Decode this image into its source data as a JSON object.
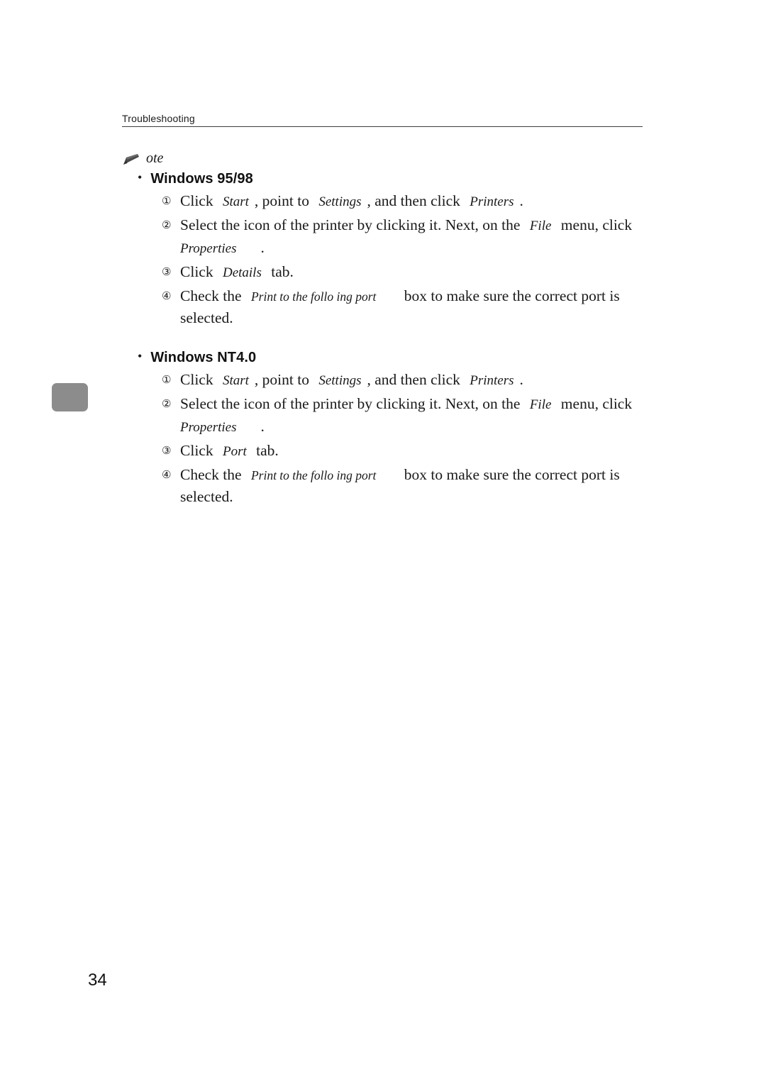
{
  "header": {
    "chapter_label": "Troubleshooting"
  },
  "note": {
    "icon": "pencil-icon",
    "label": "ote"
  },
  "sections": [
    {
      "bullet": "•",
      "title": "Windows 95/98",
      "steps": [
        {
          "num": "①",
          "parts": [
            {
              "t": "Click ",
              "s": "plain"
            },
            {
              "t": "Start",
              "s": "kw"
            },
            {
              "t": ", point to ",
              "s": "plain"
            },
            {
              "t": "Settings",
              "s": "kw"
            },
            {
              "t": ", and then click ",
              "s": "plain"
            },
            {
              "t": "Printers",
              "s": "kw"
            },
            {
              "t": ".",
              "s": "plain"
            }
          ]
        },
        {
          "num": "②",
          "parts": [
            {
              "t": "Select the icon of the printer by clicking it. Next, on the ",
              "s": "plain"
            },
            {
              "t": "File",
              "s": "kw"
            },
            {
              "t": " menu, click ",
              "s": "plain"
            },
            {
              "t": "Properties",
              "s": "kw-break"
            },
            {
              "t": ".",
              "s": "plain"
            }
          ]
        },
        {
          "num": "③",
          "parts": [
            {
              "t": "Click ",
              "s": "plain"
            },
            {
              "t": "Details",
              "s": "kw"
            },
            {
              "t": " tab.",
              "s": "plain"
            }
          ]
        },
        {
          "num": "④",
          "parts": [
            {
              "t": "Check the ",
              "s": "plain"
            },
            {
              "t": "Print to the follo ing port",
              "s": "kw-small"
            },
            {
              "t": " box to make sure the correct port is selected.",
              "s": "plain"
            }
          ]
        }
      ]
    },
    {
      "bullet": "•",
      "title": "Windows NT4.0",
      "steps": [
        {
          "num": "①",
          "parts": [
            {
              "t": "Click ",
              "s": "plain"
            },
            {
              "t": "Start",
              "s": "kw"
            },
            {
              "t": ", point to ",
              "s": "plain"
            },
            {
              "t": "Settings",
              "s": "kw"
            },
            {
              "t": ", and then click ",
              "s": "plain"
            },
            {
              "t": "Printers",
              "s": "kw"
            },
            {
              "t": ".",
              "s": "plain"
            }
          ]
        },
        {
          "num": "②",
          "parts": [
            {
              "t": "Select the icon of the printer by clicking it. Next, on the ",
              "s": "plain"
            },
            {
              "t": "File",
              "s": "kw"
            },
            {
              "t": " menu, click ",
              "s": "plain"
            },
            {
              "t": "Properties",
              "s": "kw-break"
            },
            {
              "t": ".",
              "s": "plain"
            }
          ]
        },
        {
          "num": "③",
          "parts": [
            {
              "t": "Click ",
              "s": "plain"
            },
            {
              "t": "Port",
              "s": "kw"
            },
            {
              "t": " tab.",
              "s": "plain"
            }
          ]
        },
        {
          "num": "④",
          "parts": [
            {
              "t": "Check the ",
              "s": "plain"
            },
            {
              "t": "Print to the follo ing port",
              "s": "kw-small"
            },
            {
              "t": " box to make sure the correct port is selected.",
              "s": "plain"
            }
          ]
        }
      ]
    }
  ],
  "footer": {
    "page_number": "34"
  },
  "colors": {
    "side_tab": "#8c8c8c",
    "rule": "#3d3d3d",
    "text": "#1a1a1a"
  }
}
